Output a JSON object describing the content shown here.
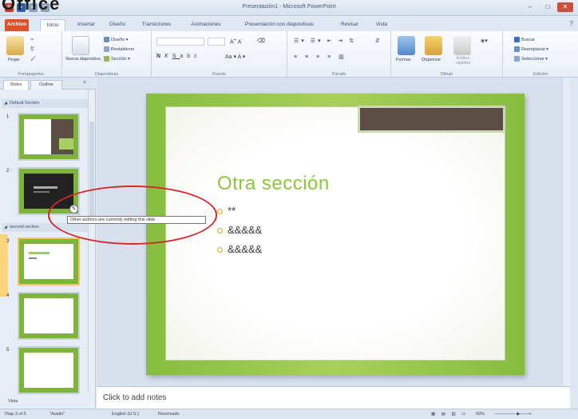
{
  "window": {
    "title": "Presentación1 - Microsoft PowerPoint"
  },
  "corner_text": "Office",
  "tabs": [
    {
      "label": "Archivo"
    },
    {
      "label": "Inicio"
    },
    {
      "label": "Insertar"
    },
    {
      "label": "Diseño"
    },
    {
      "label": "Transiciones"
    },
    {
      "label": "Animaciones"
    },
    {
      "label": "Presentación con diapositivas"
    },
    {
      "label": "Revisar"
    },
    {
      "label": "Vista"
    }
  ],
  "ribbon": {
    "clipboard": {
      "paste": "Pegar",
      "group": "Portapapeles"
    },
    "slides": {
      "new_slide": "Nueva diapositiva",
      "layout": "Diseño",
      "reset": "Restablecer",
      "section": "Sección",
      "group": "Diapositivas"
    },
    "font": {
      "group": "Fuente"
    },
    "paragraph": {
      "group": "Párrafo"
    },
    "drawing": {
      "shapes": "Formas",
      "arrange": "Organizar",
      "quick_styles": "Estilos rápidos",
      "group": "Dibujo"
    },
    "editing": {
      "find": "Buscar",
      "replace": "Reemplazar",
      "select": "Seleccionar",
      "group": "Edición"
    }
  },
  "left_panel": {
    "tabs": [
      {
        "label": "Slides"
      },
      {
        "label": "Outline"
      }
    ],
    "close": "×",
    "sections": [
      {
        "label": "Default Section"
      },
      {
        "label": "second section"
      }
    ],
    "slide_numbers": [
      "1",
      "2",
      "3",
      "4",
      "5"
    ],
    "bottom_section": "Vista"
  },
  "slide": {
    "title": "Otra sección",
    "bullets": [
      "**",
      "&&&&&",
      "&&&&&"
    ]
  },
  "tooltip": "Other authors are currently editing this slide",
  "notes_placeholder": "Click to add notes",
  "status": {
    "slide_counter": "Diap 3 of 5",
    "theme": "\"Austin\"",
    "language": "English (U.S.)",
    "mode": "Reservado",
    "zoom": "59%"
  },
  "colors": {
    "accent_green": "#8cc53e",
    "file_tab": "#d9542d",
    "annotation_red": "#d42a2a"
  }
}
